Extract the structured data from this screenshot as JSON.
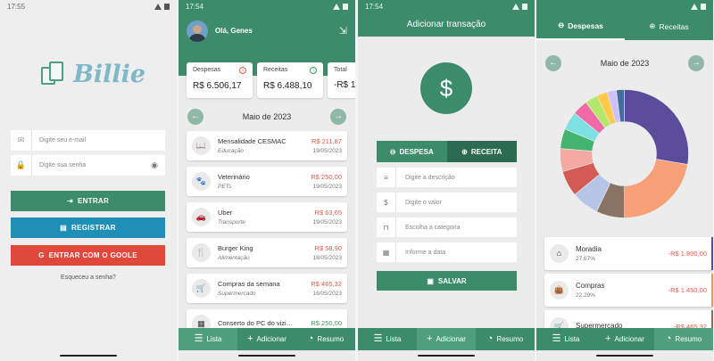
{
  "login": {
    "time": "17:55",
    "logo_text": "Billie",
    "email_placeholder": "Digite seu e-mail",
    "password_placeholder": "Digite sua senha",
    "enter_label": "ENTRAR",
    "register_label": "REGISTRAR",
    "google_label": "ENTRAR COM O GOOLE",
    "forgot_label": "Esqueceu a senha?",
    "colors": {
      "enter": "#3c8c6c",
      "register": "#1f8fb8",
      "google": "#e0483c"
    }
  },
  "list": {
    "time": "17:54",
    "greeting": "Olá, Genes",
    "cards": [
      {
        "title": "Despesas",
        "value": "R$ 6.506,17"
      },
      {
        "title": "Receitas",
        "value": "R$ 6.488,10"
      },
      {
        "title": "Total",
        "value": "-R$ 1"
      }
    ],
    "month": "Maio de 2023",
    "transactions": [
      {
        "icon": "book-icon",
        "name": "Mensalidade CESMAC",
        "category": "Educação",
        "value": "R$ 211,87",
        "date": "19/05/2023",
        "kind": "neg"
      },
      {
        "icon": "pet-icon",
        "name": "Veterinário",
        "category": "PETs",
        "value": "R$ 250,00",
        "date": "19/05/2023",
        "kind": "neg"
      },
      {
        "icon": "car-icon",
        "name": "Uber",
        "category": "Transporte",
        "value": "R$ 63,65",
        "date": "19/05/2023",
        "kind": "neg"
      },
      {
        "icon": "food-icon",
        "name": "Burger King",
        "category": "Alimentação",
        "value": "R$ 58,90",
        "date": "18/05/2023",
        "kind": "neg"
      },
      {
        "icon": "cart-icon",
        "name": "Compras da semana",
        "category": "Supermercado",
        "value": "R$ 465,32",
        "date": "16/05/2023",
        "kind": "neg"
      },
      {
        "icon": "pc-icon",
        "name": "Conserto do PC do vizi…",
        "category": "",
        "value": "R$ 250,00",
        "date": "",
        "kind": "pos"
      }
    ]
  },
  "add": {
    "time": "17:54",
    "title": "Adicionar transação",
    "expense_label": "DESPESA",
    "income_label": "RECEITA",
    "desc_placeholder": "Digite a descrição",
    "value_placeholder": "Digite o valor",
    "category_placeholder": "Escolha a categoria",
    "date_placeholder": "Informe a data",
    "save_label": "SALVAR"
  },
  "summary": {
    "tab_expenses": "Despesas",
    "tab_income": "Receitas",
    "month": "Maio de 2023",
    "items": [
      {
        "name": "Moradia",
        "percent": "27.67%",
        "value": "-R$ 1.800,00",
        "color": "#5a4c9a",
        "icon": "home-icon"
      },
      {
        "name": "Compras",
        "percent": "22.29%",
        "value": "-R$ 1.450,00",
        "color": "#f0936a",
        "icon": "bag-icon"
      },
      {
        "name": "Supermercado",
        "percent": "",
        "value": "-R$ 465,32",
        "color": "#8a6e62",
        "icon": "cart-icon"
      }
    ]
  },
  "chart_data": {
    "type": "pie",
    "values": [
      27.67,
      22.29,
      7.15,
      6.9,
      6.5,
      5.8,
      5.0,
      4.6,
      3.9,
      3.2,
      2.7,
      2.3,
      1.99
    ],
    "colors": [
      "#5a4c9a",
      "#f7a078",
      "#8a7264",
      "#b6c5e6",
      "#d35b55",
      "#f4a9a3",
      "#42b470",
      "#7fe0e4",
      "#f06aa8",
      "#b4e86a",
      "#ffc94a",
      "#ccc0ff",
      "#3f6f98"
    ]
  },
  "nav": {
    "list": "Lista",
    "add": "Adicionar",
    "summary": "Resumo"
  }
}
